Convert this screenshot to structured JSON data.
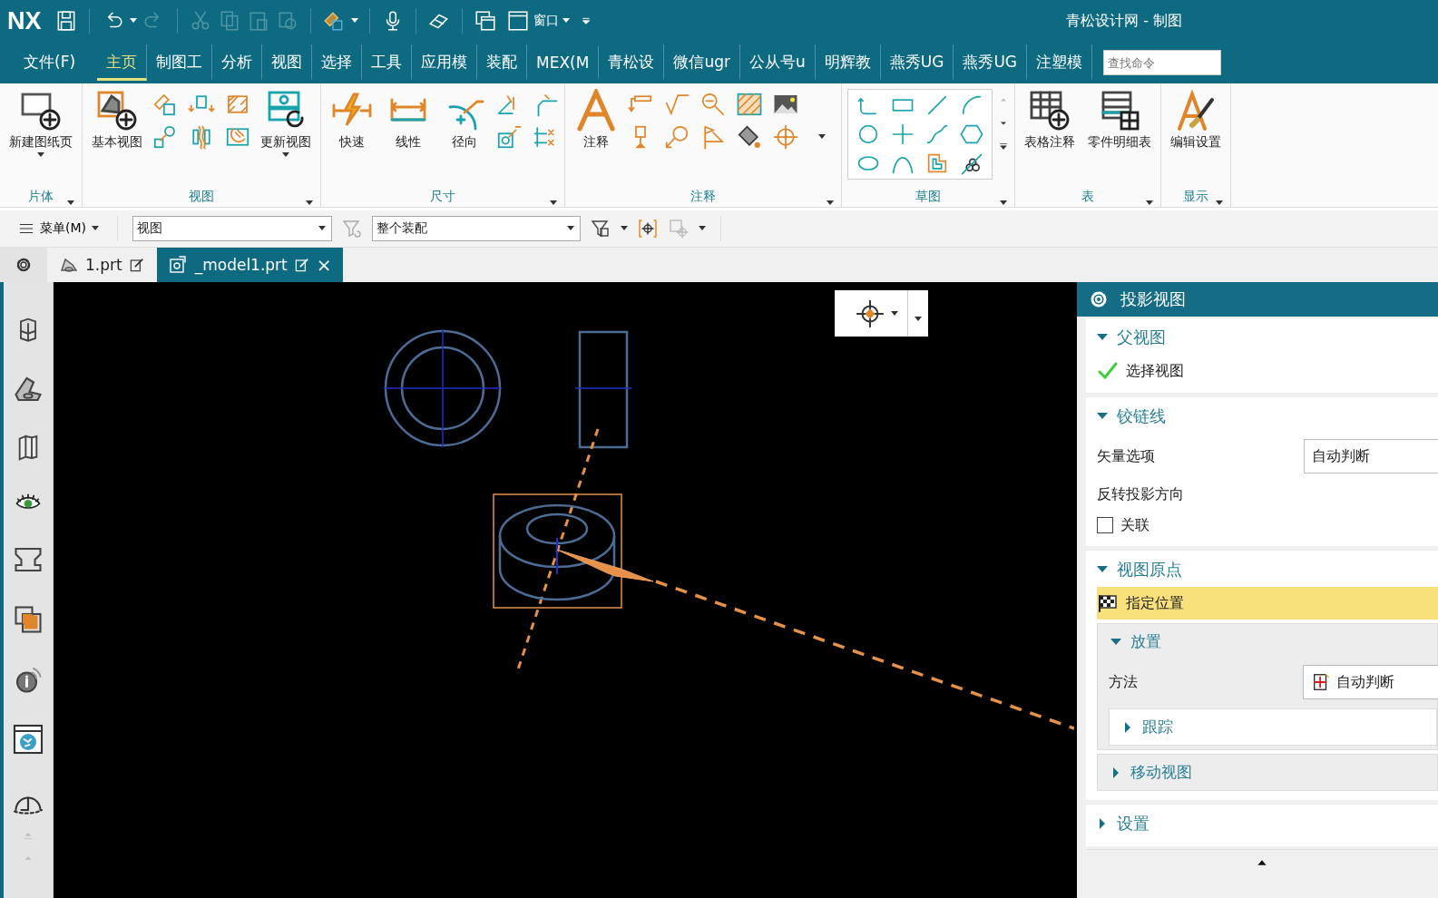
{
  "title_bar": {
    "logo": "NX",
    "window_menu": "窗口",
    "title": "青松设计网 - 制图"
  },
  "menu_tabs": [
    {
      "label": "文件(F)",
      "selected": false
    },
    {
      "label": "主页",
      "selected": true
    },
    {
      "label": "制图工",
      "selected": false
    },
    {
      "label": "分析",
      "selected": false
    },
    {
      "label": "视图",
      "selected": false
    },
    {
      "label": "选择",
      "selected": false
    },
    {
      "label": "工具",
      "selected": false
    },
    {
      "label": "应用模",
      "selected": false
    },
    {
      "label": "装配",
      "selected": false
    },
    {
      "label": "MEX(M",
      "selected": false
    },
    {
      "label": "青松设",
      "selected": false
    },
    {
      "label": "微信ugr",
      "selected": false
    },
    {
      "label": "公从号u",
      "selected": false
    },
    {
      "label": "明辉教",
      "selected": false
    },
    {
      "label": "燕秀UG",
      "selected": false
    },
    {
      "label": "燕秀UG",
      "selected": false
    },
    {
      "label": "注塑模",
      "selected": false
    }
  ],
  "search": {
    "placeholder": "查找命令"
  },
  "ribbon": {
    "groups": [
      {
        "label": "片体",
        "buttons": [
          "新建图纸页"
        ]
      },
      {
        "label": "视图",
        "buttons": [
          "基本视图",
          "更新视图"
        ]
      },
      {
        "label": "尺寸",
        "buttons": [
          "快速",
          "线性",
          "径向"
        ]
      },
      {
        "label": "注释",
        "buttons": [
          "注释"
        ]
      },
      {
        "label": "草图"
      },
      {
        "label": "表",
        "buttons": [
          "表格注释",
          "零件明细表"
        ]
      },
      {
        "label": "显示",
        "buttons": [
          "编辑设置"
        ]
      }
    ]
  },
  "toolbar": {
    "menu": "菜单(M)",
    "view_filter": "视图",
    "scope": "整个装配"
  },
  "file_tabs": [
    {
      "label": "1.prt",
      "selected": false,
      "closable": false
    },
    {
      "label": "_model1.prt",
      "selected": true,
      "closable": true
    }
  ],
  "close_glyph": "×",
  "panel": {
    "title": "投影视图",
    "sections": [
      {
        "label": "父视图",
        "expanded": true,
        "rows": [
          {
            "kind": "step",
            "label": "选择视图",
            "selected": false
          }
        ]
      },
      {
        "label": "铰链线",
        "expanded": true,
        "rows": [
          {
            "kind": "dropdown",
            "label": "矢量选项",
            "value": "自动判断"
          },
          {
            "kind": "text",
            "label": "反转投影方向"
          },
          {
            "kind": "checkbox",
            "label": "关联",
            "checked": false
          }
        ]
      },
      {
        "label": "视图原点",
        "expanded": true,
        "rows": [
          {
            "kind": "step",
            "label": "指定位置",
            "selected": true
          },
          {
            "kind": "group",
            "label": "放置",
            "expanded": true,
            "rows": [
              {
                "kind": "method",
                "label": "方法",
                "value": "自动判断"
              },
              {
                "kind": "group",
                "label": "跟踪",
                "expanded": false
              }
            ]
          },
          {
            "kind": "group",
            "label": "移动视图",
            "expanded": false
          }
        ]
      },
      {
        "label": "设置",
        "expanded": false
      }
    ]
  }
}
